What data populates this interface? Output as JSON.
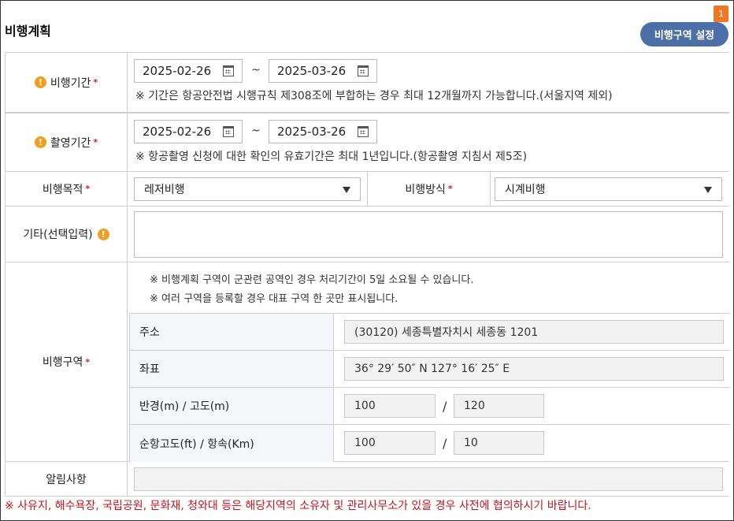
{
  "header": {
    "title": "비행계획",
    "zone_button": "비행구역 설정",
    "badge": "1"
  },
  "flight_period": {
    "label": "비행기간",
    "start": "2025-02-26",
    "end": "2025-03-26",
    "tilde": "~",
    "note": "※ 기간은 항공안전법 시행규칙 제308조에 부합하는 경우 최대 12개월까지 가능합니다.(서울지역 제외)"
  },
  "shoot_period": {
    "label": "촬영기간",
    "start": "2025-02-26",
    "end": "2025-03-26",
    "tilde": "~",
    "note": "※ 항공촬영 신청에 대한 확인의 유효기간은 최대 1년입니다.(항공촬영 지침서 제5조)"
  },
  "purpose": {
    "label": "비행목적",
    "value": "레저비행"
  },
  "method": {
    "label": "비행방식",
    "value": "시계비행"
  },
  "etc": {
    "label": "기타(선택입력)",
    "value": ""
  },
  "zone": {
    "label": "비행구역",
    "notes": [
      "※ 비행계획 구역이 군관련 공역인 경우 처리기간이 5일 소요될 수 있습니다.",
      "※ 여러 구역을 등록할 경우 대표 구역 한 곳만 표시됩니다."
    ],
    "address_label": "주소",
    "address": "(30120) 세종특별자치시 세종동 1201",
    "coord_label": "좌표",
    "coord": "36° 29′ 50″ N 127° 16′ 25″ E",
    "radius_alt_label": "반경(m) / 고도(m)",
    "radius": "100",
    "altitude": "120",
    "cruise_label": "순항고도(ft) / 항속(Km)",
    "cruise_alt": "100",
    "speed": "10",
    "slash": "/"
  },
  "notice": {
    "label": "알림사항",
    "value": ""
  },
  "required_mark": "*",
  "footnote": "※ 사유지, 해수욕장, 국립공원, 문화재, 청와대 등은 해당지역의 소유자 및 관리사무소가 있을 경우 사전에 협의하시기 바랍니다."
}
